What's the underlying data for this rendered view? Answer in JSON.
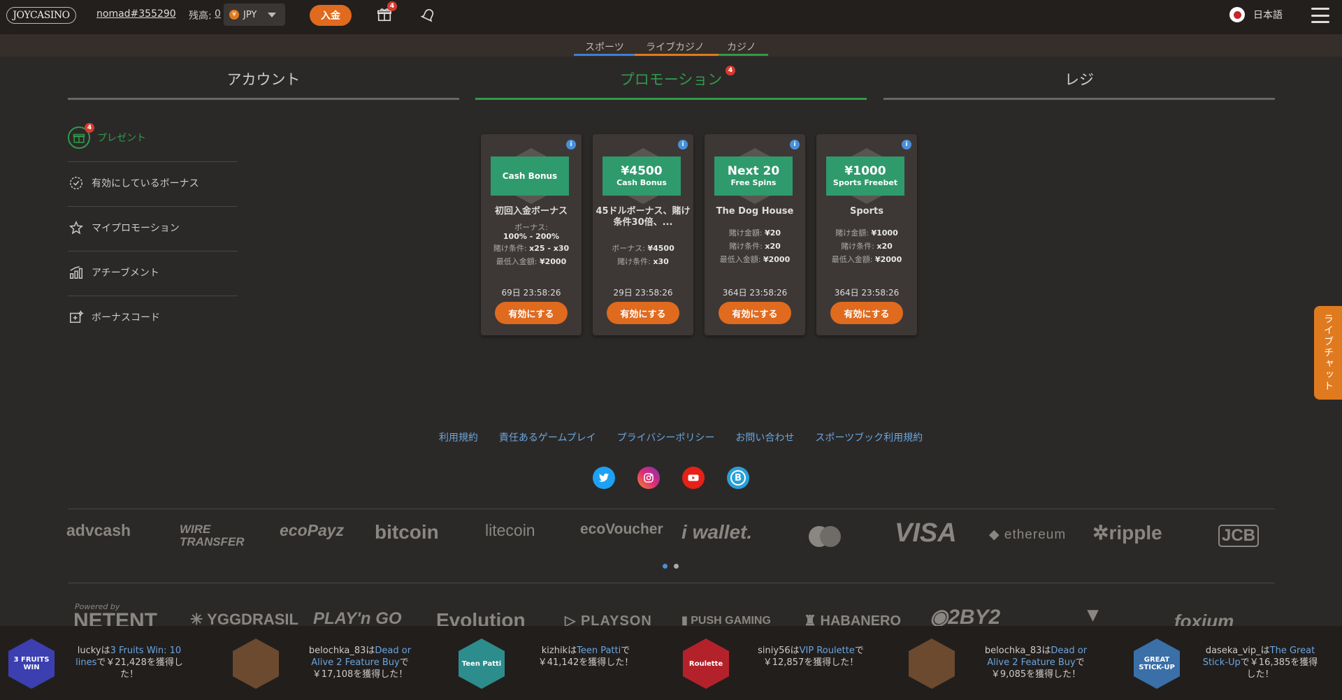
{
  "header": {
    "logo": "JOYCASINO",
    "username": "nomad#355290",
    "balance_label": "残高:",
    "balance_value": "0",
    "currency": "JPY",
    "currency_symbol": "¥",
    "deposit_label": "入金",
    "gift_badge": "4",
    "language": "日本語"
  },
  "subnav": {
    "tabs": [
      "スポーツ",
      "ライブカジノ",
      "カジノ"
    ],
    "colors": [
      "#3d7fd6",
      "#e07a1f",
      "#2f9a4c"
    ]
  },
  "main_tabs": {
    "items": [
      "アカウント",
      "プロモーション",
      "レジ"
    ],
    "active": "プロモーション",
    "promo_badge": "4"
  },
  "sidebar": {
    "items": [
      {
        "label": "プレゼント",
        "icon": "gift-icon",
        "badge": "4"
      },
      {
        "label": "有効にしているボーナス",
        "icon": "bonus-badge-icon"
      },
      {
        "label": "マイプロモーション",
        "icon": "star-icon"
      },
      {
        "label": "アチーブメント",
        "icon": "chart-bars-icon"
      },
      {
        "label": "ボーナスコード",
        "icon": "bonus-code-icon"
      }
    ]
  },
  "cards": [
    {
      "ribbon_big": "",
      "ribbon_small": "Cash Bonus",
      "title": "初回入金ボーナス",
      "line1_label": "ボーナス:",
      "line1_value": "100% - 200%",
      "line2_label": "賭け条件:",
      "line2_value": "x25 - x30",
      "line3_label": "最低入金額:",
      "line3_value": "¥2000",
      "timer": "69日  23:58:26",
      "button": "有効にする"
    },
    {
      "ribbon_big": "¥4500",
      "ribbon_small": "Cash Bonus",
      "title": "45ドルボーナス、賭け条件30倍、...",
      "line1_label": "ボーナス:",
      "line1_value": "¥4500",
      "line2_label": "賭け条件:",
      "line2_value": "x30",
      "timer": "29日  23:58:26",
      "button": "有効にする"
    },
    {
      "ribbon_big": "Next 20",
      "ribbon_small": "Free Spins",
      "title": "The Dog House",
      "line1_label": "賭け金額:",
      "line1_value": "¥20",
      "line2_label": "賭け条件:",
      "line2_value": "x20",
      "line3_label": "最低入金額:",
      "line3_value": "¥2000",
      "timer": "364日  23:58:26",
      "button": "有効にする"
    },
    {
      "ribbon_big": "¥1000",
      "ribbon_small": "Sports Freebet",
      "title": "Sports",
      "line1_label": "賭け金額:",
      "line1_value": "¥1000",
      "line2_label": "賭け条件:",
      "line2_value": "x20",
      "line3_label": "最低入金額:",
      "line3_value": "¥2000",
      "timer": "364日  23:58:26",
      "button": "有効にする"
    }
  ],
  "livechat": "ライブチャット",
  "footer": {
    "links": [
      "利用規約",
      "責任あるゲームプレイ",
      "プライバシーポリシー",
      "お問い合わせ",
      "スポーツブック利用規約"
    ],
    "payments": [
      "advcash",
      "WIRE TRANSFER",
      "ecoPayz",
      "bitcoin",
      "litecoin",
      "ecoVoucher",
      "wallet.",
      "VISA",
      "ethereum",
      "ripple",
      "JCB"
    ],
    "providers": [
      "NETENT",
      "YGGDRASIL",
      "PLAY'n GO",
      "Evolution",
      "PLAYSON",
      "PUSH GAMING",
      "HABANERO",
      "2BY2",
      "foxium"
    ],
    "powered_by": "Powered by"
  },
  "winners": [
    {
      "user": "lucky",
      "mid": "は",
      "game": "3 Fruits Win: 10 lines",
      "post": "で￥21,428を獲得した！",
      "thumb": "3 FRUITS WIN",
      "thumb_color": "#3b3fb0"
    },
    {
      "user": "belochka_83",
      "mid": "は",
      "game": "Dead or Alive 2 Feature Buy",
      "post": "で￥17,108を獲得した！",
      "thumb": "",
      "thumb_color": "#6b4a30"
    },
    {
      "user": "kizhik",
      "mid": "は",
      "game": "Teen Patti",
      "post": "で￥41,142を獲得した！",
      "thumb": "Teen Patti",
      "thumb_color": "#2d8c8c"
    },
    {
      "user": "siniy56",
      "mid": "は",
      "game": "VIP Roulette",
      "post": "で￥12,857を獲得した！",
      "thumb": "Roulette",
      "thumb_color": "#b3222a"
    },
    {
      "user": "belochka_83",
      "mid": "は",
      "game": "Dead or Alive 2 Feature Buy",
      "post": "で￥9,085を獲得した！",
      "thumb": "",
      "thumb_color": "#6b4a30"
    },
    {
      "user": "daseka_vip_",
      "mid": "は",
      "game": "The Great Stick-Up",
      "post": "で￥16,385を獲得した！",
      "thumb": "GREAT STICK-UP",
      "thumb_color": "#3a6fa8"
    }
  ]
}
